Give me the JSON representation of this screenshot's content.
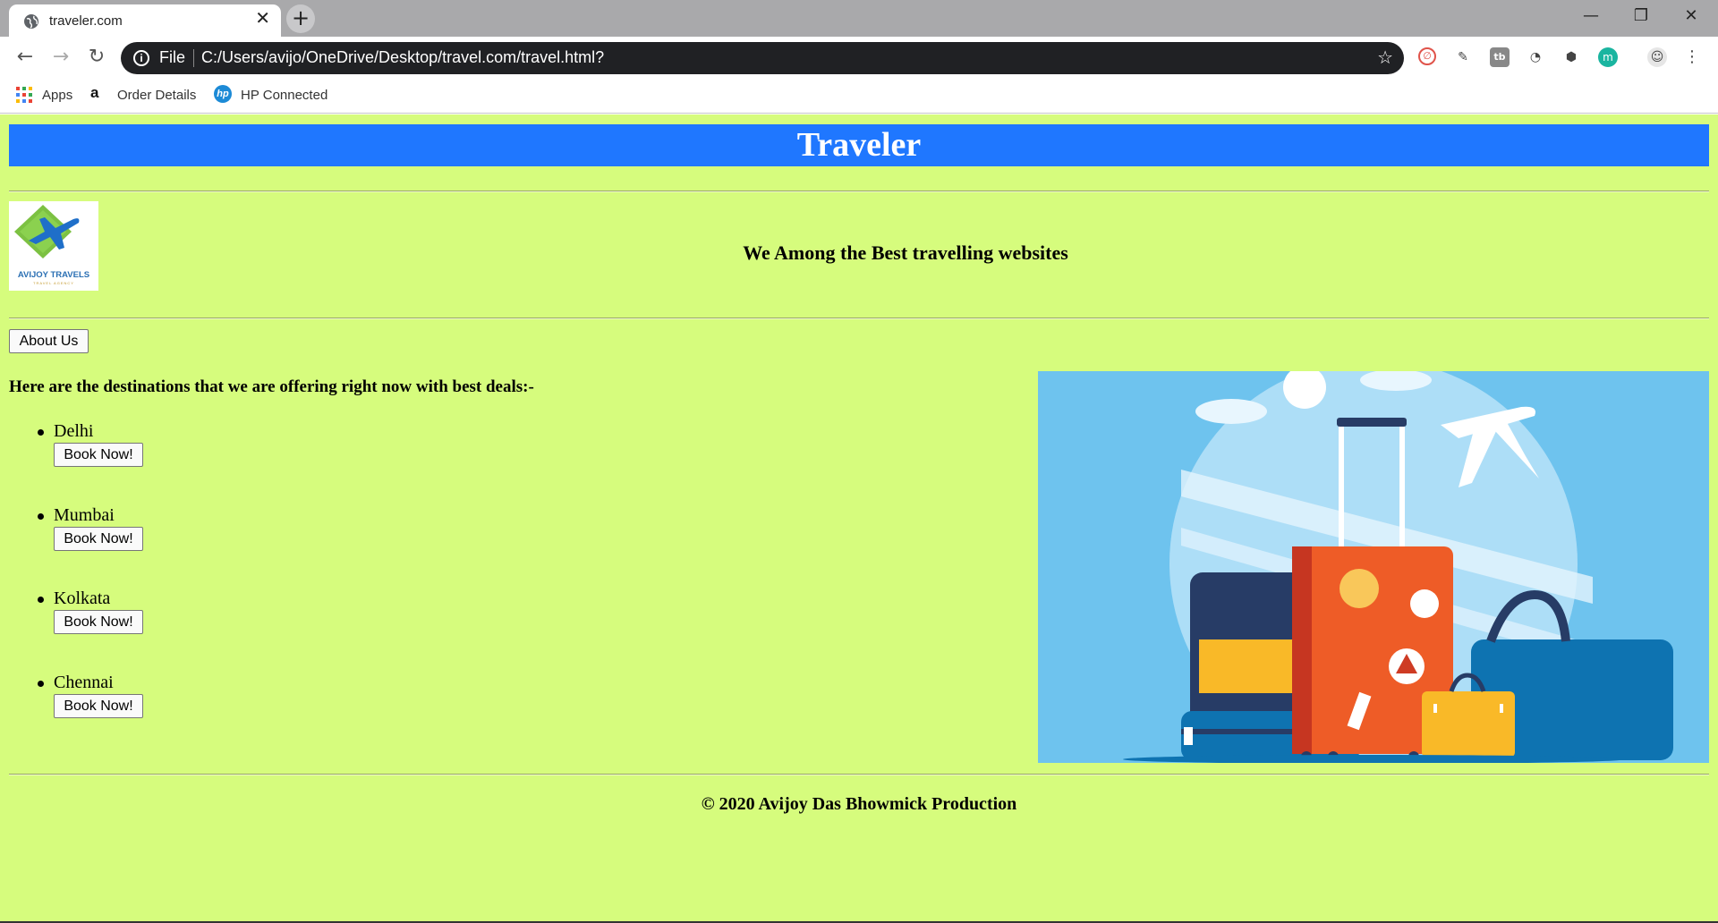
{
  "browser": {
    "tab_title": "traveler.com",
    "close_glyph": "✕",
    "new_tab_glyph": "+",
    "window_controls": {
      "minimize": "—",
      "restore": "❐",
      "close": "✕"
    },
    "nav": {
      "back": "←",
      "forward": "→",
      "reload": "↻"
    },
    "address": {
      "scheme_label": "File",
      "url": "C:/Users/avijo/OneDrive/Desktop/travel.com/travel.html?"
    },
    "star_glyph": "☆",
    "extensions": [
      "block-icon",
      "puzzle-icon",
      "tb-icon",
      "gauge-icon",
      "cube-icon",
      "m-icon"
    ],
    "bookmarks": [
      {
        "label": "Apps",
        "icon": "apps-grid-icon"
      },
      {
        "label": "Order Details",
        "icon": "amazon-icon"
      },
      {
        "label": "HP Connected",
        "icon": "hp-icon"
      }
    ],
    "menu_glyph": "⋮"
  },
  "page": {
    "banner_title": "Traveler",
    "logo": {
      "text": "AVIJOY TRAVELS",
      "subtext": "TRAVEL AGENCY"
    },
    "tagline": "We Among the Best travelling websites",
    "about_button": "About Us",
    "offer_heading": "Here are the destinations that we are offering right now with best deals:-",
    "destinations": [
      {
        "name": "Delhi",
        "button": "Book Now!"
      },
      {
        "name": "Mumbai",
        "button": "Book Now!"
      },
      {
        "name": "Kolkata",
        "button": "Book Now!"
      },
      {
        "name": "Chennai",
        "button": "Book Now!"
      }
    ],
    "footer": "© 2020 Avijoy Das Bhowmick Production",
    "colors": {
      "page_bg": "#d6fc7d",
      "banner_bg": "#1f77ff",
      "image_bg": "#6ec3ee"
    }
  }
}
